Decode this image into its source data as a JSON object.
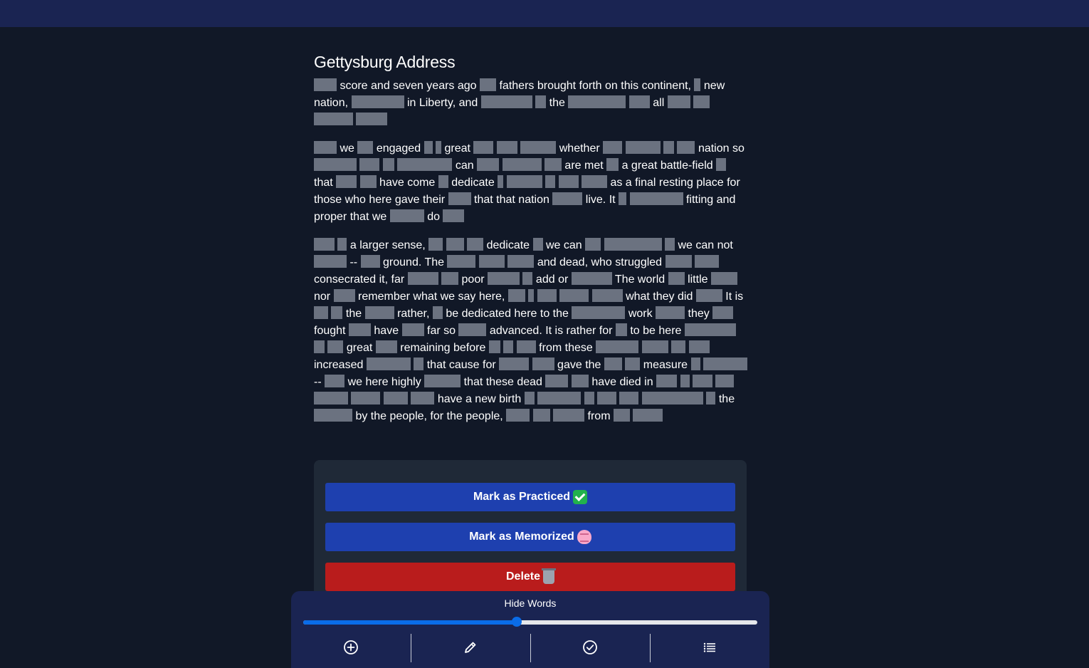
{
  "header": {},
  "document": {
    "title": "Gettysburg Address",
    "paragraphs": [
      [
        {
          "h": 32
        },
        {
          "t": "score and seven years ago"
        },
        {
          "h": 23
        },
        {
          "t": "fathers brought forth on this continent,"
        },
        {
          "h": 9
        },
        {
          "t": "new"
        },
        {
          "t": "nation,"
        },
        {
          "h": 74
        },
        {
          "t": "in Liberty, and"
        },
        {
          "h": 72
        },
        {
          "h": 15
        },
        {
          "t": "the"
        },
        {
          "h": 81
        },
        {
          "h": 29
        },
        {
          "t": "all"
        },
        {
          "h": 32
        },
        {
          "h": 23
        },
        {
          "h": 55
        },
        {
          "h": 44
        }
      ],
      [
        {
          "h": 32
        },
        {
          "t": "we"
        },
        {
          "h": 22
        },
        {
          "t": "engaged"
        },
        {
          "h": 12
        },
        {
          "h": 8
        },
        {
          "t": "great"
        },
        {
          "h": 28
        },
        {
          "h": 29
        },
        {
          "h": 50
        },
        {
          "t": "whether"
        },
        {
          "h": 27
        },
        {
          "h": 49
        },
        {
          "h": 15
        },
        {
          "h": 25
        },
        {
          "t": "nation"
        },
        {
          "t": "so"
        },
        {
          "h": 60
        },
        {
          "h": 28
        },
        {
          "h": 16
        },
        {
          "h": 77
        },
        {
          "t": "can"
        },
        {
          "h": 31
        },
        {
          "h": 55
        },
        {
          "h": 24
        },
        {
          "t": "are met"
        },
        {
          "h": 17
        },
        {
          "t": "a great battle-field"
        },
        {
          "h": 14
        },
        {
          "t": "that"
        },
        {
          "h": 29
        },
        {
          "h": 23
        },
        {
          "t": "have come"
        },
        {
          "h": 14
        },
        {
          "t": "dedicate"
        },
        {
          "h": 8
        },
        {
          "h": 50
        },
        {
          "h": 14
        },
        {
          "h": 28
        },
        {
          "h": 36
        },
        {
          "t": "as a final resting place"
        },
        {
          "t": "for those who here gave their"
        },
        {
          "h": 32
        },
        {
          "t": "that that nation"
        },
        {
          "h": 42
        },
        {
          "t": "live. It"
        },
        {
          "h": 11
        },
        {
          "h": 75
        },
        {
          "t": "fitting"
        },
        {
          "t": "and proper that we"
        },
        {
          "h": 48
        },
        {
          "t": "do"
        },
        {
          "h": 30
        }
      ],
      [
        {
          "h": 29
        },
        {
          "h": 13
        },
        {
          "t": "a larger sense,"
        },
        {
          "h": 20
        },
        {
          "h": 25
        },
        {
          "h": 23
        },
        {
          "t": "dedicate"
        },
        {
          "h": 14
        },
        {
          "t": "we can"
        },
        {
          "h": 22
        },
        {
          "h": 81
        },
        {
          "h": 14
        },
        {
          "t": "we can not"
        },
        {
          "h": 46
        },
        {
          "t": "--"
        },
        {
          "h": 27
        },
        {
          "t": "ground. The"
        },
        {
          "h": 40
        },
        {
          "h": 36
        },
        {
          "h": 37
        },
        {
          "t": "and dead, who struggled"
        },
        {
          "h": 37
        },
        {
          "h": 34
        },
        {
          "t": "consecrated it, far"
        },
        {
          "h": 43
        },
        {
          "h": 24
        },
        {
          "t": "poor"
        },
        {
          "h": 45
        },
        {
          "h": 14
        },
        {
          "t": "add or"
        },
        {
          "h": 57
        },
        {
          "t": "The world"
        },
        {
          "h": 23
        },
        {
          "t": "little"
        },
        {
          "h": 37
        },
        {
          "t": "nor"
        },
        {
          "h": 30
        },
        {
          "t": "remember what we say here,"
        },
        {
          "h": 24
        },
        {
          "h": 8
        },
        {
          "h": 27
        },
        {
          "h": 41
        },
        {
          "h": 43
        },
        {
          "t": "what they did"
        },
        {
          "h": 37
        },
        {
          "t": "It"
        },
        {
          "t": "is"
        },
        {
          "h": 20
        },
        {
          "h": 16
        },
        {
          "t": "the"
        },
        {
          "h": 41
        },
        {
          "t": "rather,"
        },
        {
          "h": 14
        },
        {
          "t": "be dedicated here to the"
        },
        {
          "h": 75
        },
        {
          "t": "work"
        },
        {
          "h": 41
        },
        {
          "t": "they"
        },
        {
          "h": 29
        },
        {
          "t": "fought"
        },
        {
          "h": 31
        },
        {
          "t": "have"
        },
        {
          "h": 31
        },
        {
          "t": "far so"
        },
        {
          "h": 39
        },
        {
          "t": "advanced. It is rather for"
        },
        {
          "h": 16
        },
        {
          "t": "to be here"
        },
        {
          "h": 72
        },
        {
          "h": 15
        },
        {
          "h": 22
        },
        {
          "t": "great"
        },
        {
          "h": 30
        },
        {
          "t": "remaining before"
        },
        {
          "h": 16
        },
        {
          "h": 14
        },
        {
          "h": 27
        },
        {
          "t": "from these"
        },
        {
          "h": 60
        },
        {
          "h": 37
        },
        {
          "h": 20
        },
        {
          "h": 29
        },
        {
          "t": "increased"
        },
        {
          "h": 62
        },
        {
          "h": 14
        },
        {
          "t": "that cause for"
        },
        {
          "h": 42
        },
        {
          "h": 31
        },
        {
          "t": "gave the"
        },
        {
          "h": 25
        },
        {
          "h": 21
        },
        {
          "t": "measure"
        },
        {
          "h": 13
        },
        {
          "h": 62
        },
        {
          "t": "--"
        },
        {
          "h": 28
        },
        {
          "t": "we here highly"
        },
        {
          "h": 51
        },
        {
          "t": "that these dead"
        },
        {
          "h": 32
        },
        {
          "h": 24
        },
        {
          "t": "have died in"
        },
        {
          "h": 29
        },
        {
          "h": 13
        },
        {
          "h": 28
        },
        {
          "h": 26
        },
        {
          "h": 48
        },
        {
          "h": 41
        },
        {
          "h": 34
        },
        {
          "h": 33
        },
        {
          "t": "have a new birth"
        },
        {
          "h": 14
        },
        {
          "h": 61
        },
        {
          "h": 14
        },
        {
          "h": 27
        },
        {
          "h": 27
        },
        {
          "h": 86
        },
        {
          "h": 13
        },
        {
          "t": "the"
        },
        {
          "h": 54
        },
        {
          "t": "by the people, for the people,"
        },
        {
          "h": 33
        },
        {
          "h": 24
        },
        {
          "h": 44
        },
        {
          "t": "from"
        },
        {
          "h": 23
        },
        {
          "h": 42
        }
      ]
    ]
  },
  "actions": {
    "practiced_label": "Mark as Practiced",
    "memorized_label": "Mark as Memorized",
    "delete_label": "Delete"
  },
  "controls": {
    "hide_words_label": "Hide Words",
    "hide_words_value": 0.47
  },
  "nav": {
    "items": [
      {
        "name": "add",
        "icon": "plus-circle-icon"
      },
      {
        "name": "edit",
        "icon": "pencil-icon"
      },
      {
        "name": "check",
        "icon": "check-circle-icon"
      },
      {
        "name": "list",
        "icon": "list-icon"
      }
    ]
  },
  "colors": {
    "background": "#111827",
    "header": "#1a2452",
    "hidden_word": "#6b7280",
    "primary_button": "#1e40af",
    "delete_button": "#b91c1c",
    "slider": "#0a6ce8"
  }
}
